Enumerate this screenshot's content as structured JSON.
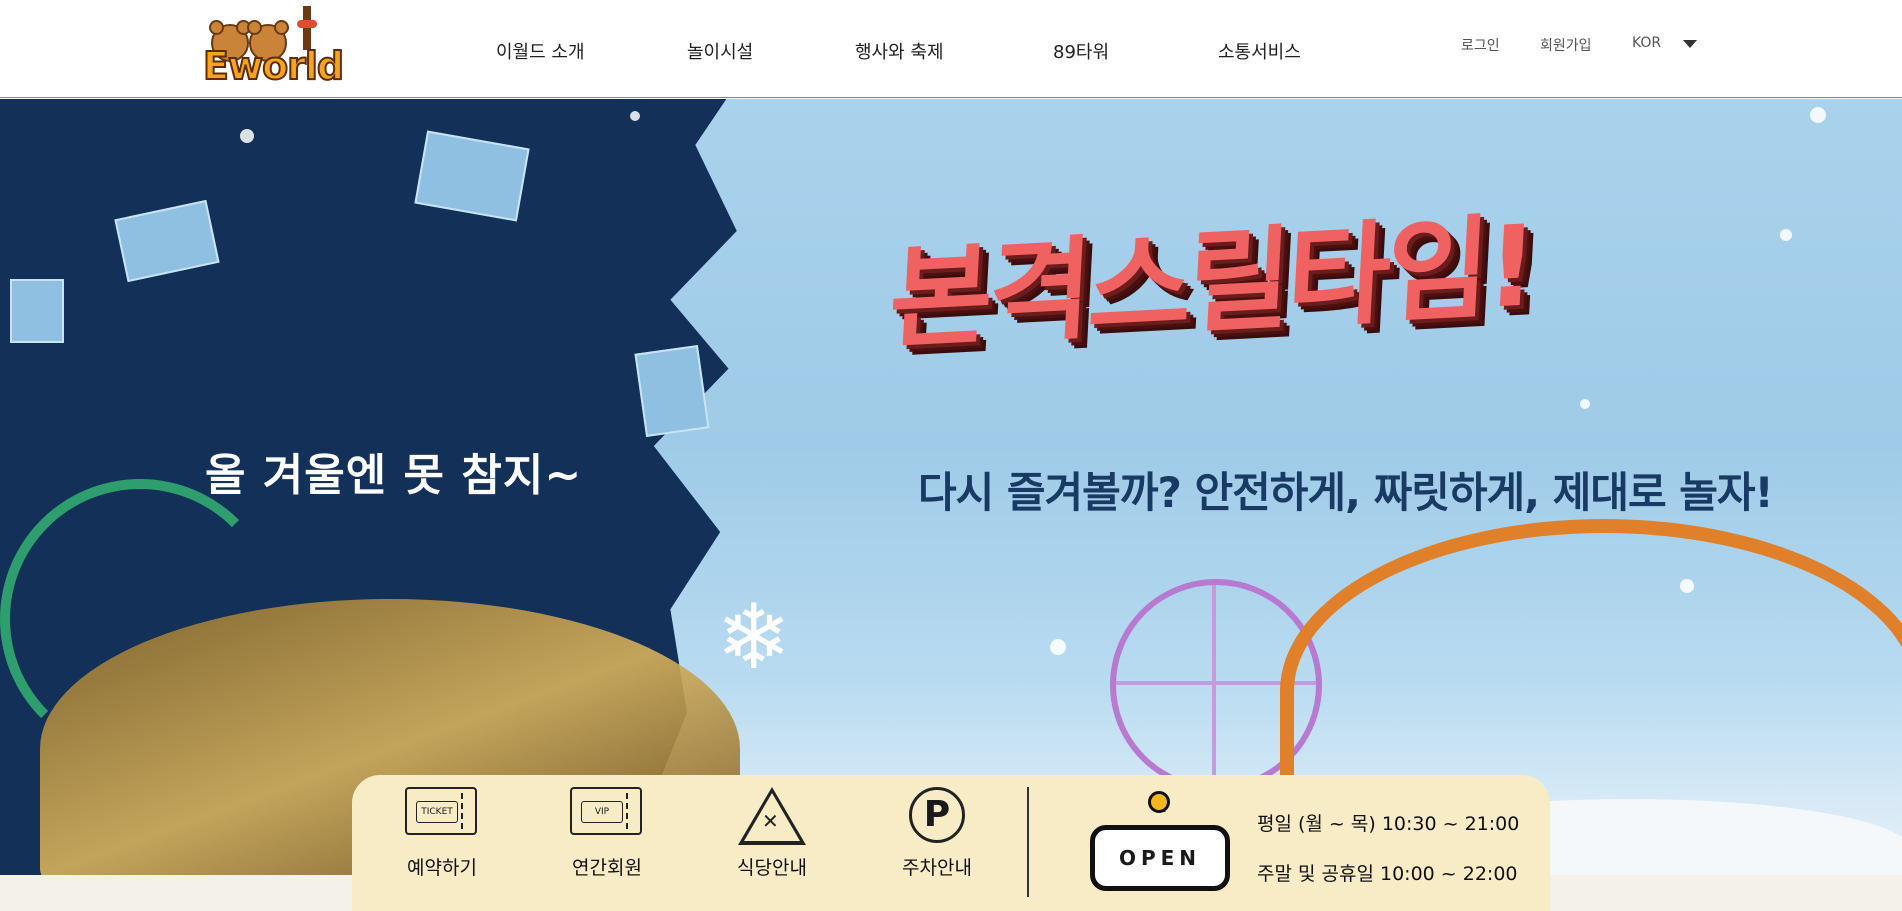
{
  "header": {
    "logo_text": "Eworld",
    "nav": [
      "이월드 소개",
      "놀이시설",
      "행사와 축제",
      "89타워",
      "소통서비스"
    ],
    "login": "로그인",
    "signup": "회원가입",
    "language": "KOR"
  },
  "hero": {
    "subtitle": "올 겨울엔 못 참지~",
    "title": "본격스릴타임!",
    "caption": "다시 즐겨볼까? 안전하게, 짜릿하게, 제대로 놀자!"
  },
  "quick_menu": [
    {
      "label": "예약하기",
      "icon": "ticket-icon",
      "icon_text": "TICKET"
    },
    {
      "label": "연간회원",
      "icon": "vip-ticket-icon",
      "icon_text": "VIP"
    },
    {
      "label": "식당안내",
      "icon": "restaurant-icon"
    },
    {
      "label": "주차안내",
      "icon": "parking-icon",
      "icon_text": "P"
    }
  ],
  "open_status": {
    "sign": "OPEN",
    "weekday_hours": "평일 (월 ~ 목) 10:30 ~ 21:00",
    "weekend_hours": "주말 및 공휴일 10:00 ~ 22:00"
  },
  "colors": {
    "title_red": "#f06262",
    "caption_navy": "#183a63",
    "info_bar_bg": "#f8ecc7",
    "sky": "#a9d2ec",
    "hole_navy": "#123058"
  }
}
